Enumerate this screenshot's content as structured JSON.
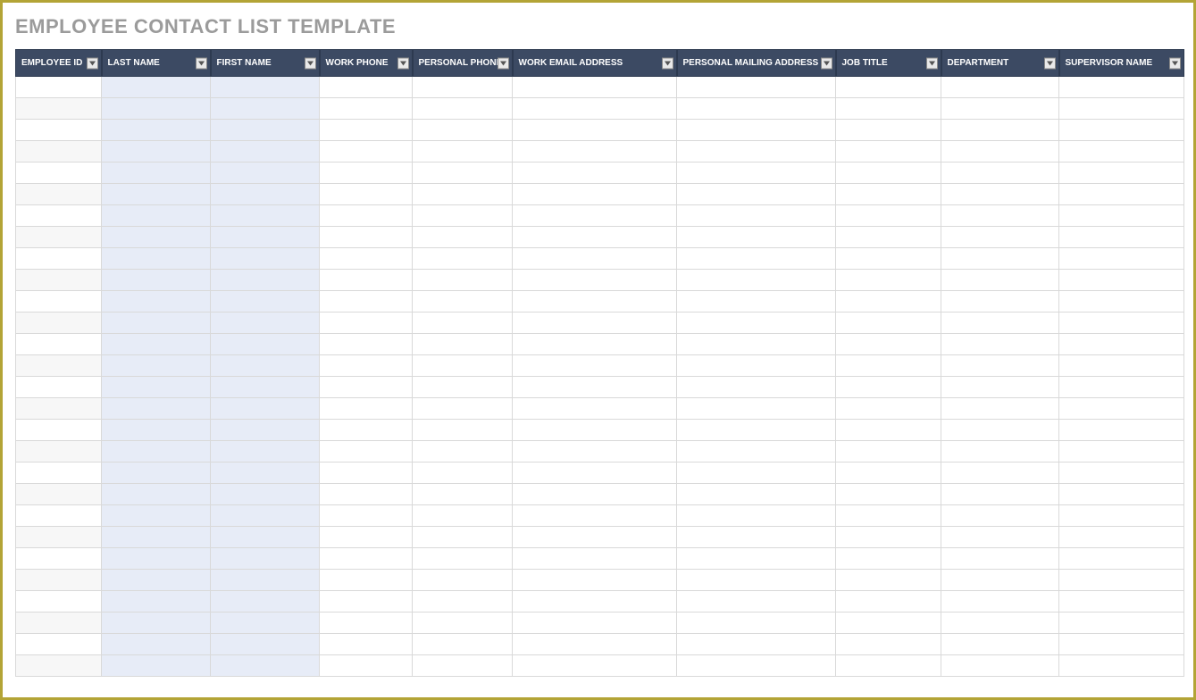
{
  "title": "EMPLOYEE CONTACT LIST TEMPLATE",
  "columns": [
    {
      "label": "EMPLOYEE ID"
    },
    {
      "label": "LAST NAME"
    },
    {
      "label": "FIRST NAME"
    },
    {
      "label": "WORK PHONE"
    },
    {
      "label": "PERSONAL PHONE"
    },
    {
      "label": "WORK EMAIL ADDRESS"
    },
    {
      "label": "PERSONAL MAILING ADDRESS"
    },
    {
      "label": "JOB TITLE"
    },
    {
      "label": "DEPARTMENT"
    },
    {
      "label": "SUPERVISOR NAME"
    }
  ],
  "row_count": 28,
  "shaded_columns": [
    1,
    2
  ],
  "alt_first_column": true,
  "colors": {
    "frame_border": "#b3a436",
    "header_bg": "#3c4a63",
    "header_text": "#ffffff",
    "title_text": "#9b9b9b",
    "shade_bg": "#e7ecf7",
    "alt_bg": "#f7f7f7",
    "grid": "#d9d9d9"
  }
}
